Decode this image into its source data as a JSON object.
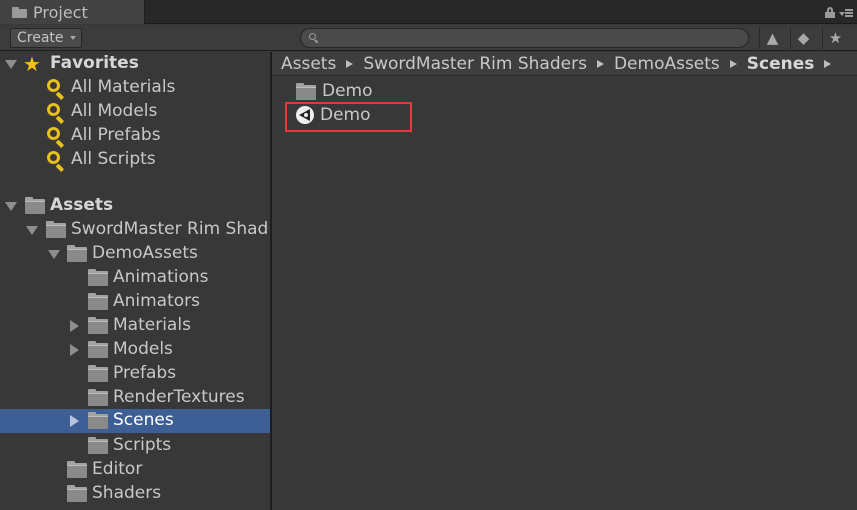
{
  "window": {
    "tab_label": "Project"
  },
  "toolbar": {
    "create_label": "Create",
    "search_placeholder": "",
    "buttons": [
      "filter-by-type-icon",
      "filter-by-label-icon",
      "favorite-star-icon"
    ]
  },
  "favorites": {
    "header": "Favorites",
    "items": [
      "All Materials",
      "All Models",
      "All Prefabs",
      "All Scripts"
    ]
  },
  "assets": {
    "header": "Assets",
    "tree": [
      {
        "label": "SwordMaster Rim Shad"
      },
      {
        "label": "DemoAssets"
      },
      {
        "label": "Animations"
      },
      {
        "label": "Animators"
      },
      {
        "label": "Materials"
      },
      {
        "label": "Models"
      },
      {
        "label": "Prefabs"
      },
      {
        "label": "RenderTextures"
      },
      {
        "label": "Scenes",
        "selected": true
      },
      {
        "label": "Scripts"
      },
      {
        "label": "Editor"
      },
      {
        "label": "Shaders"
      }
    ]
  },
  "breadcrumb": [
    "Assets",
    "SwordMaster Rim Shaders",
    "DemoAssets",
    "Scenes"
  ],
  "content": {
    "items": [
      {
        "label": "Demo",
        "type": "folder"
      },
      {
        "label": "Demo",
        "type": "scene",
        "highlighted": true
      }
    ]
  },
  "colors": {
    "selection": "#3e5f96",
    "highlight_box": "#e03a3a",
    "favorite_icon": "#e8c020"
  }
}
